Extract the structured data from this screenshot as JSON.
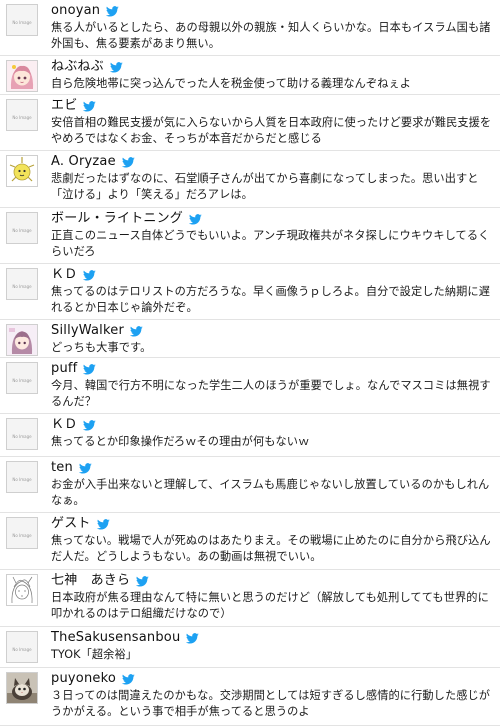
{
  "colors": {
    "bird": "#1da1f2",
    "divider": "#e3e3e3",
    "text": "#1a1a1a"
  },
  "placeholder_text": "No Image",
  "tweets": [
    {
      "user": "onoyan",
      "avatar": "placeholder",
      "text": "焦る人がいるとしたら、あの母親以外の親族・知人くらいかな。日本もイスラム国も諸外国も、焦る要素があまり無い。"
    },
    {
      "user": "ねぶねぶ",
      "avatar": "pink-anime-girl",
      "text": "自ら危険地帯に突っ込んでった人を税金使って助ける義理なんぞねぇよ"
    },
    {
      "user": "エビ",
      "avatar": "placeholder",
      "text": "安倍首相の難民支援が気に入らないから人質を日本政府に使ったけど要求が難民支援をやめろではなくお金、そっちが本音だからだと感じる"
    },
    {
      "user": "A. Oryzae",
      "avatar": "yellow-mascot",
      "text": "悲劇だったはずなのに、石堂順子さんが出てから喜劇になってしまった。思い出すと「泣ける」より「笑える」だろアレは。"
    },
    {
      "user": "ボール・ライトニング",
      "avatar": "placeholder",
      "text": "正直このニュース自体どうでもいいよ。アンチ現政権共がネタ探しにウキウキしてるくらいだろ"
    },
    {
      "user": "ＫＤ",
      "avatar": "placeholder",
      "text": "焦ってるのはテロリストの方だろうな。早く画像うｐしろよ。自分で設定した納期に遅れるとか日本じゃ論外だぞ。"
    },
    {
      "user": "SillyWalker",
      "avatar": "anime-girl",
      "text": "どっちも大事です。"
    },
    {
      "user": "puff",
      "avatar": "placeholder",
      "text": "今月、韓国で行方不明になった学生二人のほうが重要でしょ。なんでマスコミは無視するんだ？"
    },
    {
      "user": "ＫＤ",
      "avatar": "placeholder",
      "text": "焦ってるとか印象操作だろｗその理由が何もないｗ"
    },
    {
      "user": "ten",
      "avatar": "placeholder",
      "text": "お金が入手出来ないと理解して、イスラムも馬鹿じゃないし放置しているのかもしれんなぁ。"
    },
    {
      "user": "ゲスト",
      "avatar": "placeholder",
      "text": "焦ってない。戦場で人が死ぬのはあたりまえ。その戦場に止めたのに自分から飛び込んだ人だ。どうしようもない。あの動画は無視でいい。"
    },
    {
      "user": "七神　あきら",
      "avatar": "sketch-character",
      "text": "日本政府が焦る理由なんて特に無いと思うのだけど（解放しても処刑してても世界的に叩かれるのはテロ組織だけなので）"
    },
    {
      "user": "TheSakusensanbou",
      "avatar": "placeholder",
      "text": "TYOK「超余裕」"
    },
    {
      "user": "puyoneko",
      "avatar": "cat-photo",
      "text": "３日ってのは間違えたのかもな。交渉期間としては短すぎるし感情的に行動した感じがうかがえる。という事で相手が焦ってると思うのよ"
    }
  ]
}
